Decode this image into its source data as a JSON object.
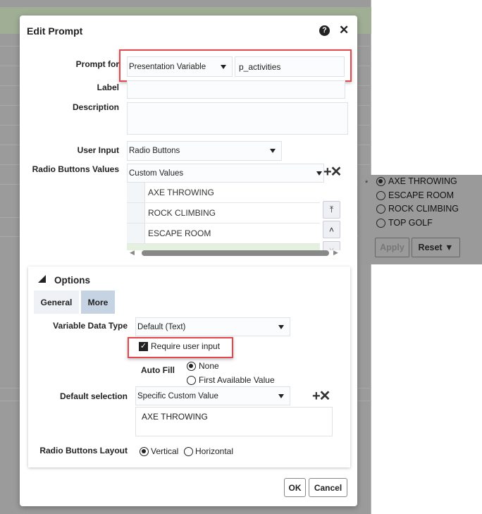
{
  "dialog": {
    "title": "Edit Prompt",
    "help_icon": "help-icon",
    "close_icon": "close-icon"
  },
  "form": {
    "prompt_for_label": "Prompt for",
    "prompt_for_value": "Presentation Variable",
    "variable_name": "p_activities",
    "label_label": "Label",
    "label_value": "",
    "description_label": "Description",
    "description_value": "",
    "user_input_label": "User Input",
    "user_input_value": "Radio Buttons",
    "radio_values_label": "Radio Buttons Values",
    "radio_values_source": "Custom Values",
    "values": [
      "AXE THROWING",
      "ROCK CLIMBING",
      "ESCAPE ROOM"
    ]
  },
  "options": {
    "title": "Options",
    "tabs": [
      "General",
      "More"
    ],
    "active_tab": "More",
    "variable_data_type_label": "Variable Data Type",
    "variable_data_type_value": "Default (Text)",
    "require_user_input_label": "Require user input",
    "require_user_input_checked": true,
    "auto_fill_label": "Auto Fill",
    "auto_fill_options": [
      "None",
      "First Available Value"
    ],
    "auto_fill_selected": "None",
    "default_selection_label": "Default selection",
    "default_selection_value": "Specific Custom Value",
    "default_selection_text": "AXE THROWING",
    "layout_label": "Radio Buttons Layout",
    "layout_options": [
      "Vertical",
      "Horizontal"
    ],
    "layout_selected": "Vertical"
  },
  "footer": {
    "ok": "OK",
    "cancel": "Cancel"
  },
  "preview": {
    "required_mark": "*",
    "options": [
      "AXE THROWING",
      "ESCAPE ROOM",
      "ROCK CLIMBING",
      "TOP GOLF"
    ],
    "selected": "AXE THROWING",
    "apply": "Apply",
    "reset": "Reset ▼"
  },
  "colors": {
    "highlight": "#e8464e",
    "overlay": "#9b9b9b"
  }
}
